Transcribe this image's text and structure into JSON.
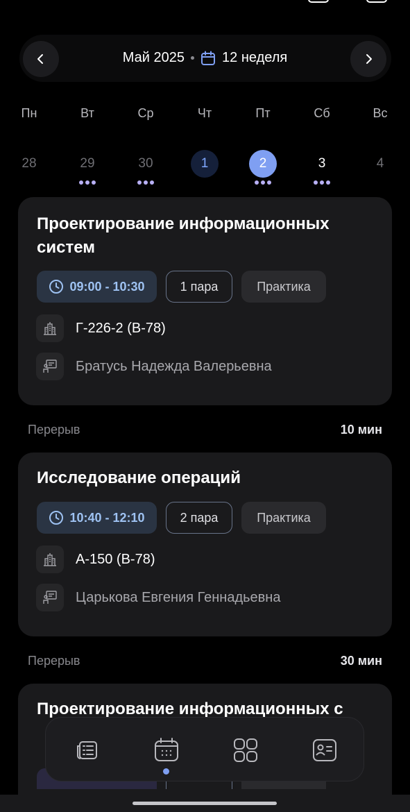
{
  "header": {
    "month": "Май 2025",
    "week": "12 неделя"
  },
  "weekdays": [
    "Пн",
    "Вт",
    "Ср",
    "Чт",
    "Пт",
    "Сб",
    "Вс"
  ],
  "dates": [
    {
      "day": "28",
      "state": "past",
      "events": 0
    },
    {
      "day": "29",
      "state": "past",
      "events": 3
    },
    {
      "day": "30",
      "state": "past",
      "events": 3
    },
    {
      "day": "1",
      "state": "today",
      "events": 0
    },
    {
      "day": "2",
      "state": "selected",
      "events": 3
    },
    {
      "day": "3",
      "state": "upcoming",
      "events": 3
    },
    {
      "day": "4",
      "state": "past",
      "events": 0
    }
  ],
  "lessons": [
    {
      "title": "Проектирование информационных систем",
      "time": "09:00 - 10:30",
      "pair": "1 пара",
      "kind": "Практика",
      "room": "Г-226-2 (В-78)",
      "teacher": "Братусь Надежда Валерьевна"
    },
    {
      "title": "Исследование операций",
      "time": "10:40 - 12:10",
      "pair": "2 пара",
      "kind": "Практика",
      "room": "А-150 (В-78)",
      "teacher": "Царькова Евгения Геннадьевна"
    },
    {
      "title": "Проектирование информационных с"
    }
  ],
  "breaks": [
    {
      "label": "Перерыв",
      "duration": "10 мин"
    },
    {
      "label": "Перерыв",
      "duration": "30 мин"
    }
  ],
  "tabbar": {
    "items": [
      "news-icon",
      "calendar-icon",
      "apps-grid-icon",
      "profile-card-icon"
    ],
    "active": "calendar-icon"
  },
  "colors": {
    "accent": "#7f9ff2",
    "card": "#1a1a1c",
    "time_chip": "#2a3443",
    "event_dot": "#b8b0f5"
  }
}
